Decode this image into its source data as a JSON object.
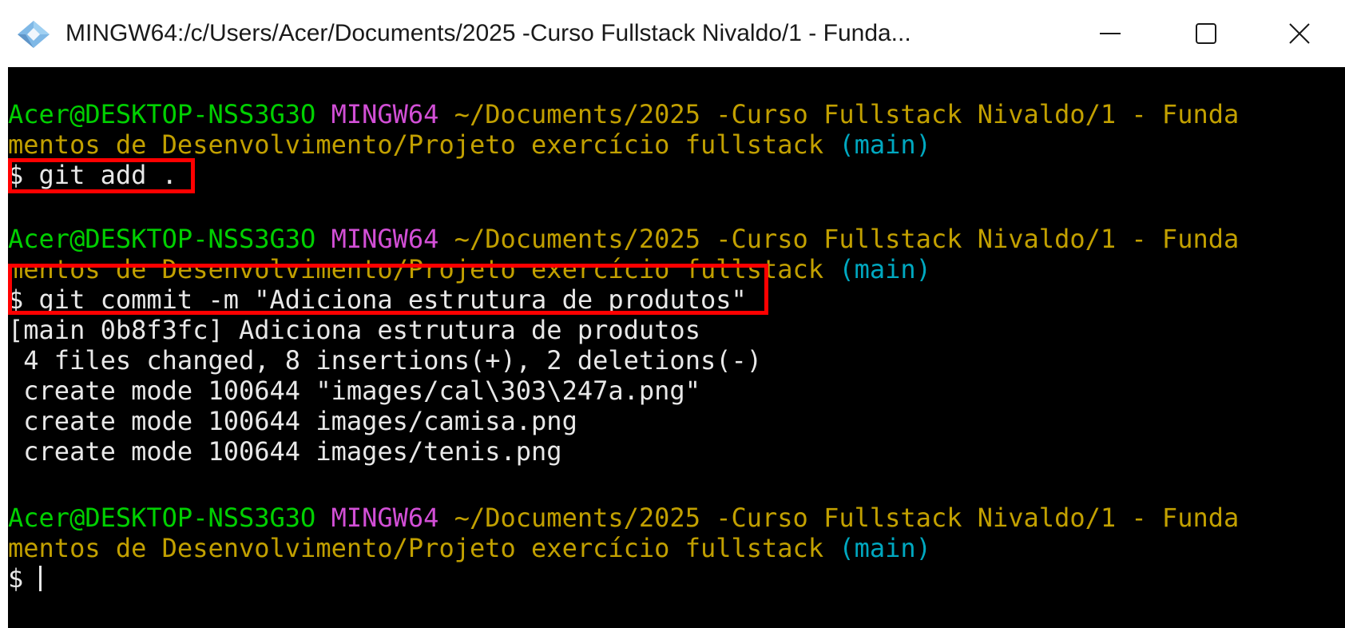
{
  "window": {
    "title": "MINGW64:/c/Users/Acer/Documents/2025 -Curso Fullstack Nivaldo/1 - Funda...",
    "icon": "git-bash-icon",
    "controls": {
      "minimize_icon": "minimize-icon",
      "maximize_icon": "maximize-icon",
      "close_icon": "close-icon"
    }
  },
  "colors": {
    "terminal_bg": "#000000",
    "user_host": "#00d000",
    "shell_name": "#d24fd6",
    "path": "#c2a000",
    "branch": "#00a8c0",
    "highlight": "#ff0000"
  },
  "terminal": {
    "prompts": [
      {
        "user_host": "Acer@DESKTOP-NSS3G3O",
        "shell": "MINGW64",
        "path_line1": "~/Documents/2025 -Curso Fullstack Nivaldo/1 - Funda",
        "path_line2": "mentos de Desenvolvimento/Projeto exercício fullstack",
        "branch": "(main)",
        "command": "$ git add ."
      },
      {
        "user_host": "Acer@DESKTOP-NSS3G3O",
        "shell": "MINGW64",
        "path_line1": "~/Documents/2025 -Curso Fullstack Nivaldo/1 - Funda",
        "path_line2": "mentos de Desenvolvimento/Projeto exercício fullstack",
        "branch": "(main)",
        "command": "$ git commit -m \"Adiciona estrutura de produtos\""
      },
      {
        "user_host": "Acer@DESKTOP-NSS3G3O",
        "shell": "MINGW64",
        "path_line1": "~/Documents/2025 -Curso Fullstack Nivaldo/1 - Funda",
        "path_line2": "mentos de Desenvolvimento/Projeto exercício fullstack",
        "branch": "(main)",
        "command": "$ "
      }
    ],
    "commit_output": [
      "[main 0b8f3fc] Adiciona estrutura de produtos",
      " 4 files changed, 8 insertions(+), 2 deletions(-)",
      " create mode 100644 \"images/cal\\303\\247a.png\"",
      " create mode 100644 images/camisa.png",
      " create mode 100644 images/tenis.png"
    ]
  }
}
